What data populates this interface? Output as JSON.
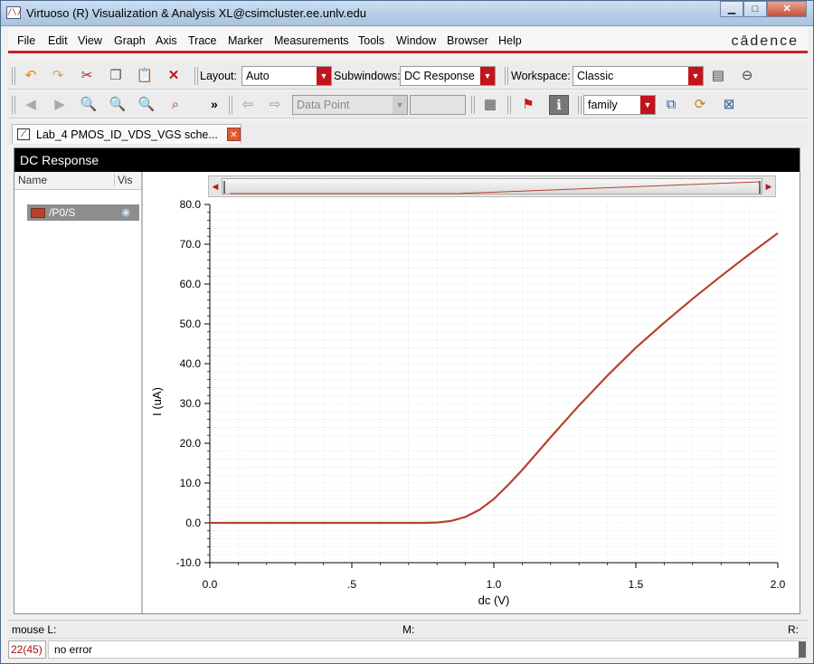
{
  "window": {
    "title": "Virtuoso (R) Visualization & Analysis XL@csimcluster.ee.unlv.edu",
    "app_icon": "waveform-icon",
    "controls": [
      "minimize",
      "maximize",
      "close"
    ]
  },
  "menubar": {
    "items": [
      "File",
      "Edit",
      "View",
      "Graph",
      "Axis",
      "Trace",
      "Marker",
      "Measurements",
      "Tools",
      "Window",
      "Browser",
      "Help"
    ],
    "logo": "cādence"
  },
  "toolbar1": {
    "layout_label": "Layout:",
    "layout_value": "Auto",
    "subwindows_label": "Subwindows:",
    "subwindows_value": "DC Response",
    "workspace_label": "Workspace:",
    "workspace_value": "Classic",
    "icons": [
      "undo-icon",
      "redo-icon",
      "cut-icon",
      "copy-icon",
      "paste-icon",
      "delete-icon"
    ]
  },
  "toolbar2": {
    "more_glyph": "»",
    "marker_type_value": "Data Point",
    "family_value": "family"
  },
  "tab": {
    "label": "Lab_4 PMOS_ID_VDS_VGS sche..."
  },
  "subwindow": {
    "title": "DC Response",
    "columns": {
      "name": "Name",
      "vis": "Vis"
    },
    "signals": [
      {
        "name": "/P0/S",
        "color": "#b4432b"
      }
    ]
  },
  "chart_data": {
    "type": "line",
    "xlabel": "dc (V)",
    "ylabel": "I (uA)",
    "xlim": [
      0.0,
      2.0
    ],
    "ylim": [
      -10.0,
      80.0
    ],
    "x_ticks": [
      "0.0",
      ".5",
      "1.0",
      "1.5",
      "2.0"
    ],
    "x_tick_values": [
      0.0,
      0.5,
      1.0,
      1.5,
      2.0
    ],
    "y_ticks": [
      "-10.0",
      "0.0",
      "10.0",
      "20.0",
      "30.0",
      "40.0",
      "50.0",
      "60.0",
      "70.0",
      "80.0"
    ],
    "y_tick_values": [
      -10,
      0,
      10,
      20,
      30,
      40,
      50,
      60,
      70,
      80
    ],
    "grid": true,
    "series": [
      {
        "name": "/P0/S",
        "color": "#b4432b",
        "x": [
          0.0,
          0.2,
          0.4,
          0.6,
          0.75,
          0.8,
          0.85,
          0.9,
          0.95,
          1.0,
          1.05,
          1.1,
          1.2,
          1.3,
          1.4,
          1.5,
          1.6,
          1.7,
          1.8,
          1.9,
          2.0
        ],
        "y": [
          0.0,
          0.0,
          0.0,
          0.0,
          0.0,
          0.1,
          0.5,
          1.5,
          3.3,
          6.0,
          9.5,
          13.3,
          21.5,
          29.5,
          37.0,
          44.0,
          50.3,
          56.3,
          62.0,
          67.5,
          72.8
        ]
      }
    ]
  },
  "status": {
    "mouse_l": "mouse L:",
    "mouse_m": "M:",
    "mouse_r": "R:",
    "counter": "22(45)",
    "message": "no error"
  }
}
